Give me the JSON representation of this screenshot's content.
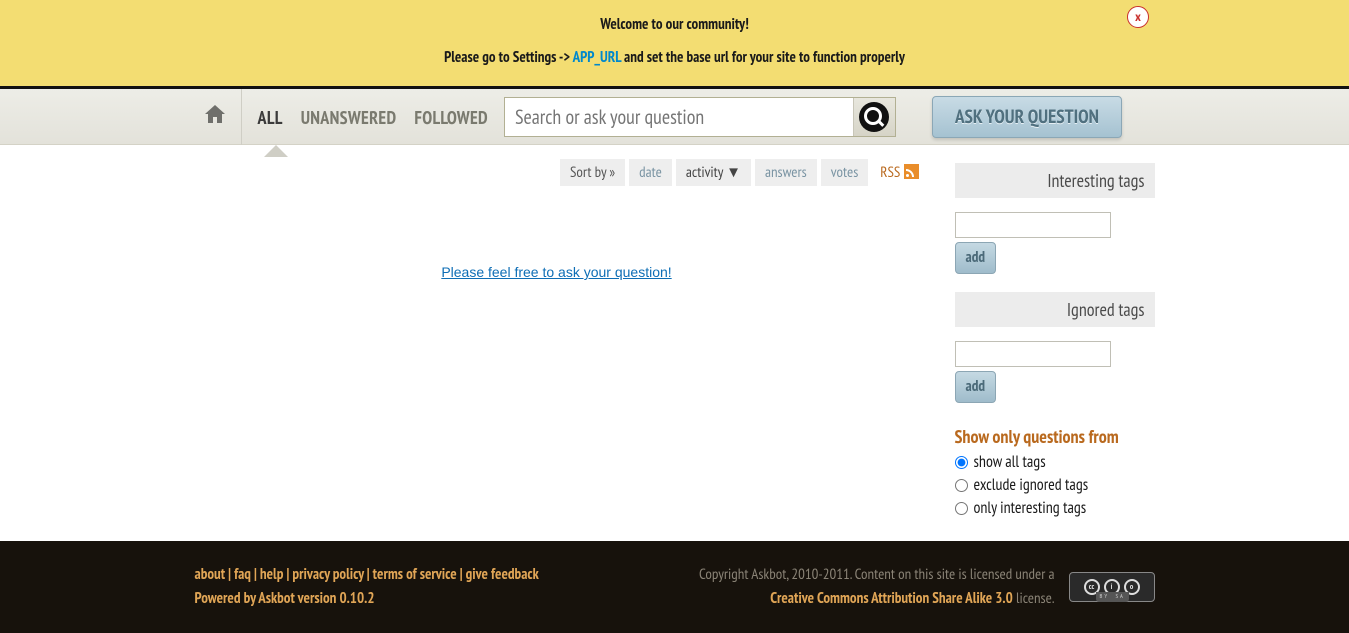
{
  "banner": {
    "line1": "Welcome to our community!",
    "line2a": "Please go to Settings -> ",
    "line2_link": "APP_URL",
    "line2b": " and set the base url for your site to function properly",
    "close": "x"
  },
  "nav": {
    "scope": [
      {
        "label": "ALL",
        "active": true
      },
      {
        "label": "UNANSWERED",
        "active": false
      },
      {
        "label": "FOLLOWED",
        "active": false
      }
    ],
    "search_placeholder": "Search or ask your question",
    "ask_button": "ASK YOUR QUESTION"
  },
  "sort": {
    "label": "Sort by »",
    "items": [
      {
        "label": "date",
        "active": false
      },
      {
        "label": "activity ▼",
        "active": true
      },
      {
        "label": "answers",
        "active": false
      },
      {
        "label": "votes",
        "active": false
      }
    ],
    "rss": "RSS"
  },
  "empty": {
    "prompt": "Please feel free to ask your question!"
  },
  "sidebar": {
    "interesting": "Interesting tags",
    "ignored": "Ignored tags",
    "add": "add",
    "filter_heading": "Show only questions from",
    "filters": [
      {
        "label": "show all tags",
        "checked": true
      },
      {
        "label": "exclude ignored tags",
        "checked": false
      },
      {
        "label": "only interesting tags",
        "checked": false
      }
    ]
  },
  "footer": {
    "links": [
      "about",
      "faq",
      "help",
      "privacy policy",
      "terms of service",
      "give feedback"
    ],
    "sep": " | ",
    "powered": "Powered by Askbot version 0.10.2",
    "copyright_a": "Copyright Askbot, 2010-2011. Content on this site is licensed under a ",
    "cc_link": "Creative Commons Attribution Share Alike 3.0",
    "copyright_b": " license."
  }
}
